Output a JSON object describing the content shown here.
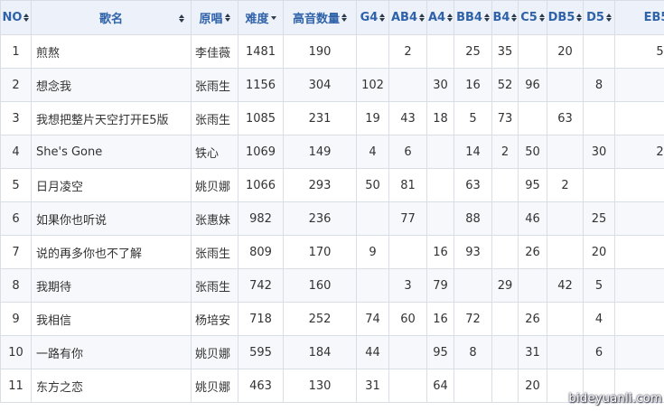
{
  "table": {
    "columns": [
      "NO",
      "歌名",
      "原唱",
      "难度",
      "高音数量",
      "G4",
      "AB4",
      "A4",
      "BB4",
      "B4",
      "C5",
      "DB5",
      "D5",
      "EB5"
    ],
    "sorted_column": "难度",
    "rows": [
      [
        "1",
        "煎熬",
        "李佳薇",
        "1481",
        "190",
        "",
        "2",
        "",
        "25",
        "35",
        "",
        "20",
        "",
        "5"
      ],
      [
        "2",
        "想念我",
        "张雨生",
        "1156",
        "304",
        "102",
        "",
        "30",
        "16",
        "52",
        "96",
        "",
        "8",
        ""
      ],
      [
        "3",
        "我想把整片天空打开E5版",
        "张雨生",
        "1085",
        "231",
        "19",
        "43",
        "18",
        "5",
        "73",
        "",
        "63",
        "",
        ""
      ],
      [
        "4",
        "She's Gone",
        "铁心",
        "1069",
        "149",
        "4",
        "6",
        "",
        "14",
        "2",
        "50",
        "",
        "30",
        "2"
      ],
      [
        "5",
        "日月凌空",
        "姚贝娜",
        "1066",
        "293",
        "50",
        "81",
        "",
        "63",
        "",
        "95",
        "2",
        "",
        ""
      ],
      [
        "6",
        "如果你也听说",
        "张惠妹",
        "982",
        "236",
        "",
        "77",
        "",
        "88",
        "",
        "46",
        "",
        "25",
        ""
      ],
      [
        "7",
        "说的再多你也不了解",
        "张雨生",
        "809",
        "170",
        "9",
        "",
        "16",
        "93",
        "",
        "26",
        "",
        "20",
        ""
      ],
      [
        "8",
        "我期待",
        "张雨生",
        "742",
        "160",
        "",
        "3",
        "79",
        "",
        "29",
        "",
        "42",
        "5",
        ""
      ],
      [
        "9",
        "我相信",
        "杨培安",
        "718",
        "252",
        "74",
        "60",
        "16",
        "72",
        "",
        "26",
        "",
        "4",
        ""
      ],
      [
        "10",
        "一路有你",
        "姚贝娜",
        "595",
        "184",
        "44",
        "",
        "95",
        "8",
        "",
        "31",
        "",
        "6",
        ""
      ],
      [
        "11",
        "东方之恋",
        "姚贝娜",
        "463",
        "130",
        "31",
        "",
        "64",
        "",
        "",
        "20",
        "",
        "",
        ""
      ]
    ]
  },
  "watermark": "bideyuanli.com"
}
